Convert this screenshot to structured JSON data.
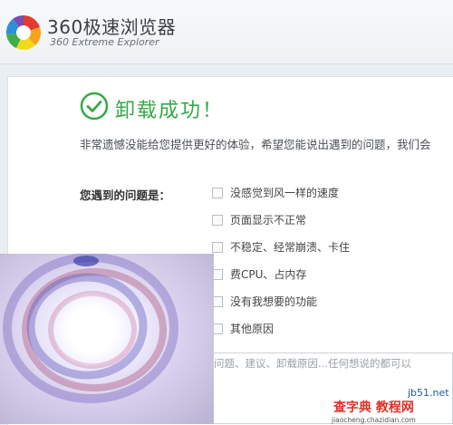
{
  "header": {
    "title": "360极速浏览器",
    "subtitle": "360 Extreme Explorer"
  },
  "main": {
    "success_title": "卸载成功！",
    "apology": "非常遗憾没能给您提供更好的体验，希望您能说出遇到的问题，我们会",
    "question_label": "您遇到的问题是：",
    "options": [
      {
        "label": "没感觉到风一样的速度",
        "checked": false
      },
      {
        "label": "页面显示不正常",
        "checked": false
      },
      {
        "label": "不稳定、经常崩溃、卡住",
        "checked": false
      },
      {
        "label": "费CPU、占内存",
        "checked": false
      },
      {
        "label": "没有我想要的功能",
        "checked": false
      },
      {
        "label": "其他原因",
        "checked": false
      }
    ],
    "feedback_placeholder": "问题、建议、卸载原因...任何想说的都可以"
  },
  "watermark": {
    "site": "jb51.net",
    "text_cn": "查字典 教程网",
    "url": "jiaocheng.chazidian.com"
  },
  "colors": {
    "success_green": "#34a946",
    "watermark_red": "#d9342b"
  }
}
